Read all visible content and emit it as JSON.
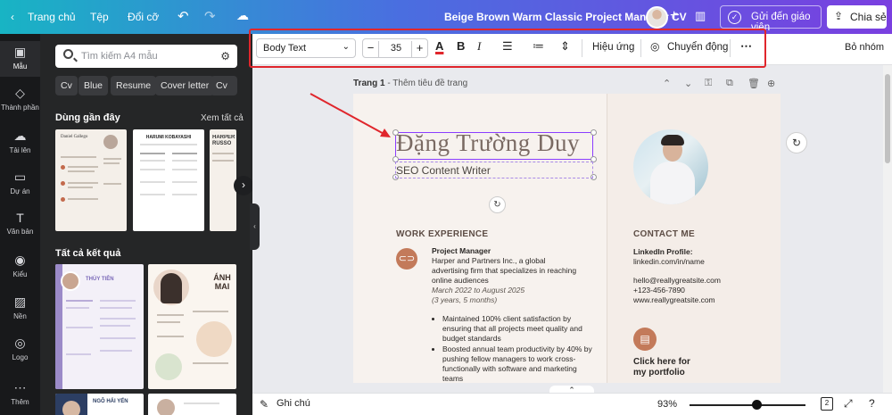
{
  "topbar": {
    "home": "Trang chủ",
    "file": "Tệp",
    "resize": "Đổi cỡ",
    "title": "Beige Brown Warm Classic Project Manager CV",
    "send_teacher": "Gửi đến giáo viên",
    "share": "Chia sẻ"
  },
  "rail": [
    {
      "label": "Mẫu",
      "icon": "template-icon"
    },
    {
      "label": "Thành phần",
      "icon": "elements-icon"
    },
    {
      "label": "Tải lên",
      "icon": "upload-icon"
    },
    {
      "label": "Dự án",
      "icon": "folder-icon"
    },
    {
      "label": "Văn bản",
      "icon": "text-icon"
    },
    {
      "label": "Kiểu",
      "icon": "palette-icon"
    },
    {
      "label": "Nền",
      "icon": "background-icon"
    },
    {
      "label": "Logo",
      "icon": "logo-icon"
    },
    {
      "label": "Thêm",
      "icon": "more-icon"
    }
  ],
  "panel": {
    "search_placeholder": "Tìm kiếm A4 mẫu",
    "chips": [
      "Cv",
      "Blue",
      "Resume",
      "Cover letter",
      "Cv"
    ],
    "recent_title": "Dùng gần đây",
    "see_all": "Xem tất cả",
    "all_results": "Tất cả kết quả",
    "thumb_names": [
      "Daniel Gallego",
      "HARUMI KOBAYASHI",
      "HARPER RUSSO",
      "THÙY TIÊN",
      "ÁNH MAI",
      "NGÔ HẢI YẾN"
    ]
  },
  "toolbar": {
    "font": "Body Text",
    "font_size": "35",
    "effects": "Hiệu ứng",
    "animate": "Chuyển động",
    "ungroup": "Bỏ nhóm"
  },
  "page": {
    "label": "Trang 1",
    "add_title": "Thêm tiêu đề trang"
  },
  "cv": {
    "name": "Đặng Trường Duy",
    "role": "SEO Content Writer",
    "work_title": "WORK EXPERIENCE",
    "job_title": "Project Manager",
    "job_company_1": "Harper and Partners Inc., a global",
    "job_company_2": "advertising firm that specializes in reaching",
    "job_company_3": "online audiences",
    "job_dates": "March 2022 to August 2025",
    "job_duration": "(3 years, 5 months)",
    "bullets": [
      "Maintained 100% client satisfaction by ensuring that all projects meet quality and budget standards",
      "Boosted annual team productivity by 40% by pushing fellow managers to work cross-functionally with software and marketing teams"
    ],
    "contact_title": "CONTACT ME",
    "linkedin_label": "LinkedIn Profile:",
    "linkedin_value": "linkedin.com/in/name",
    "email": "hello@reallygreatsite.com",
    "phone": "+123-456-7890",
    "website": "www.reallygreatsite.com",
    "portfolio_1": "Click here for",
    "portfolio_2": "my portfolio"
  },
  "bottombar": {
    "notes": "Ghi chú",
    "zoom": "93%",
    "zoom_level": 0.55,
    "page_count": "2"
  },
  "colors": {
    "accent": "#8b3dff",
    "highlight_box": "#e0262c",
    "cv_accent": "#c37a5a"
  }
}
